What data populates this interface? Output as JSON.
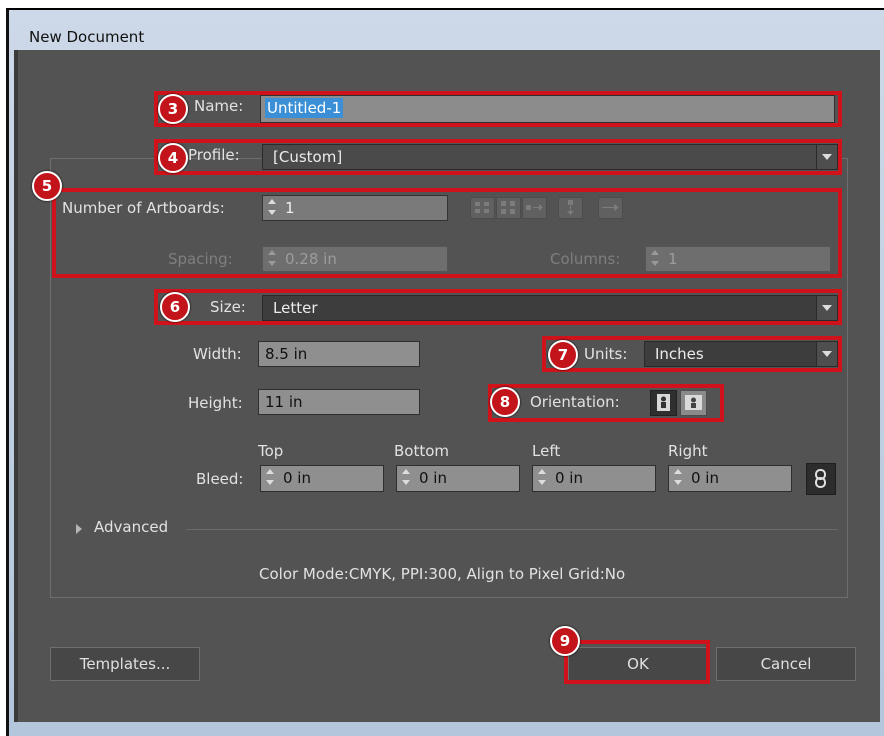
{
  "window": {
    "title": "New Document"
  },
  "name": {
    "label": "Name:",
    "value": "Untitled-1"
  },
  "profile": {
    "label": "Profile:",
    "value": "[Custom]"
  },
  "artboards": {
    "count_label": "Number of Artboards:",
    "count_value": "1",
    "spacing_label": "Spacing:",
    "spacing_value": "0.28 in",
    "columns_label": "Columns:",
    "columns_value": "1"
  },
  "size": {
    "label": "Size:",
    "value": "Letter"
  },
  "width": {
    "label": "Width:",
    "value": "8.5 in"
  },
  "height": {
    "label": "Height:",
    "value": "11 in"
  },
  "units": {
    "label": "Units:",
    "value": "Inches"
  },
  "orientation": {
    "label": "Orientation:"
  },
  "bleed": {
    "label": "Bleed:",
    "top_label": "Top",
    "top_value": "0 in",
    "bottom_label": "Bottom",
    "bottom_value": "0 in",
    "left_label": "Left",
    "left_value": "0 in",
    "right_label": "Right",
    "right_value": "0 in"
  },
  "advanced": {
    "label": "Advanced"
  },
  "summary": "Color Mode:CMYK, PPI:300, Align to Pixel Grid:No",
  "buttons": {
    "templates": "Templates...",
    "ok": "OK",
    "cancel": "Cancel"
  },
  "callouts": [
    "3",
    "4",
    "5",
    "6",
    "7",
    "8",
    "9"
  ],
  "colors": {
    "highlight": "#d0121a",
    "dialog_bg": "#535353",
    "selection": "#3b8fd6"
  }
}
